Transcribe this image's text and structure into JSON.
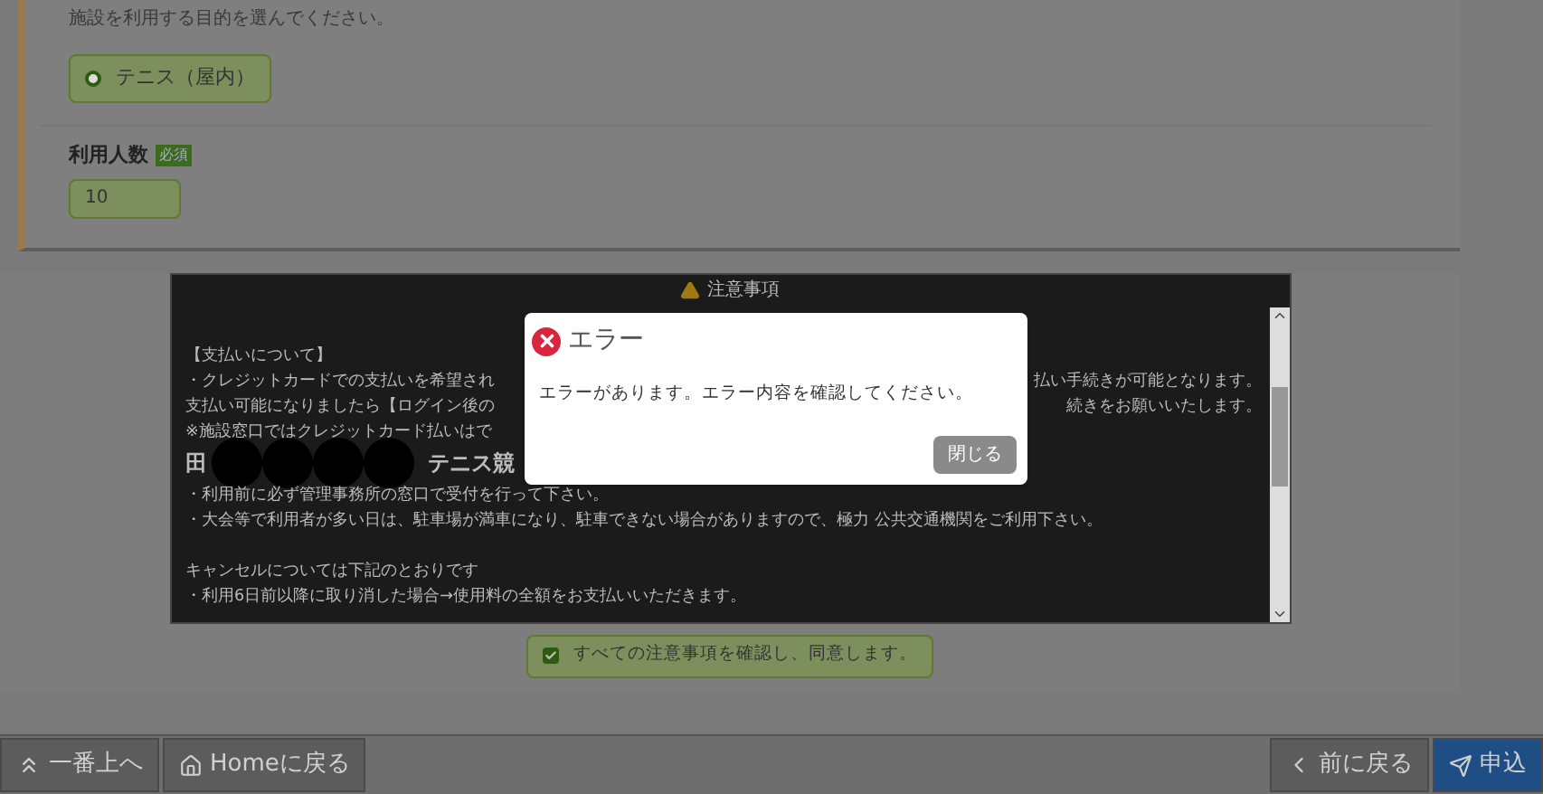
{
  "purpose": {
    "hint": "施設を利用する目的を選んでください。",
    "options": [
      {
        "label": "テニス（屋内）",
        "selected": true
      }
    ]
  },
  "people": {
    "label": "利用人数",
    "badge": "必須",
    "value": "10"
  },
  "notice": {
    "title": "注意事項",
    "lines": [
      {
        "kind": "blank"
      },
      {
        "kind": "text",
        "left": "【支払いについて】"
      },
      {
        "kind": "text",
        "left": "・クレジットカードでの支払いを希望され",
        "right": "払い手続きが可能となります。"
      },
      {
        "kind": "text",
        "left": "支払い可能になりましたら【ログイン後の",
        "right": "続きをお願いいたします。"
      },
      {
        "kind": "text",
        "left": "※施設窓口ではクレジットカード払いはで"
      },
      {
        "kind": "heading",
        "left": "田",
        "right": "テニス競"
      },
      {
        "kind": "text",
        "left": "・利用前に必ず管理事務所の窓口で受付を行って下さい。"
      },
      {
        "kind": "text",
        "left": "・大会等で利用者が多い日は、駐車場が満車になり、駐車できない場合がありますので、極力 公共交通機関をご利用下さい。"
      },
      {
        "kind": "blank"
      },
      {
        "kind": "text",
        "left": "キャンセルについては下記のとおりです"
      },
      {
        "kind": "text",
        "left": "・利用6日前以降に取り消した場合→使用料の全額をお支払いいただきます。"
      }
    ]
  },
  "agree": {
    "label": "すべての注意事項を確認し、同意します。",
    "checked": true
  },
  "footer": {
    "left": [
      {
        "kind": "top",
        "label": "一番上へ"
      },
      {
        "kind": "home",
        "label": "Homeに戻る"
      }
    ],
    "right": [
      {
        "kind": "back",
        "label": "前に戻る"
      },
      {
        "kind": "submit",
        "label": "申込"
      }
    ]
  },
  "dialog": {
    "title": "エラー",
    "message": "エラーがあります。エラー内容を確認してください。",
    "button": "閉じる"
  }
}
